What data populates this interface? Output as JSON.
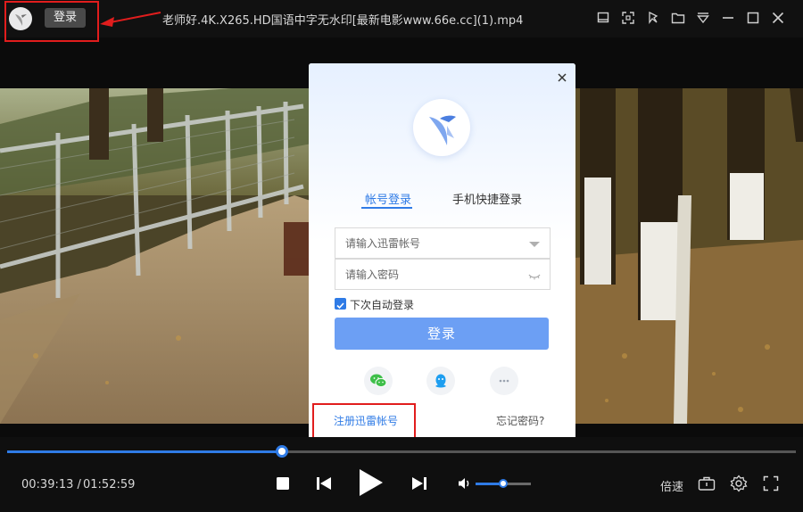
{
  "titlebar": {
    "login_label": "登录",
    "file_title": "老师好.4K.X265.HD国语中字无水印[最新电影www.66e.cc](1).mp4",
    "window_controls": [
      "mini-player-icon",
      "screenshot-icon",
      "pin-icon",
      "folder-icon",
      "menu-icon",
      "minimize-icon",
      "maximize-icon",
      "close-icon"
    ]
  },
  "dialog": {
    "tabs": [
      {
        "label": "帐号登录",
        "active": true
      },
      {
        "label": "手机快捷登录",
        "active": false
      }
    ],
    "account_placeholder": "请输入迅雷帐号",
    "password_placeholder": "请输入密码",
    "auto_login_label": "下次自动登录",
    "auto_login_checked": true,
    "submit_label": "登录",
    "social": [
      "wechat-icon",
      "qq-icon",
      "more-icon"
    ],
    "register_label": "注册迅雷帐号",
    "forgot_label": "忘记密码?"
  },
  "player": {
    "current_time": "00:39:13 /",
    "total_time": "01:52:59",
    "progress_fraction": 0.348,
    "volume_fraction": 0.5,
    "speed_label": "倍速",
    "accent_color": "#2f7be6",
    "annotation_color": "#e11d1d"
  }
}
